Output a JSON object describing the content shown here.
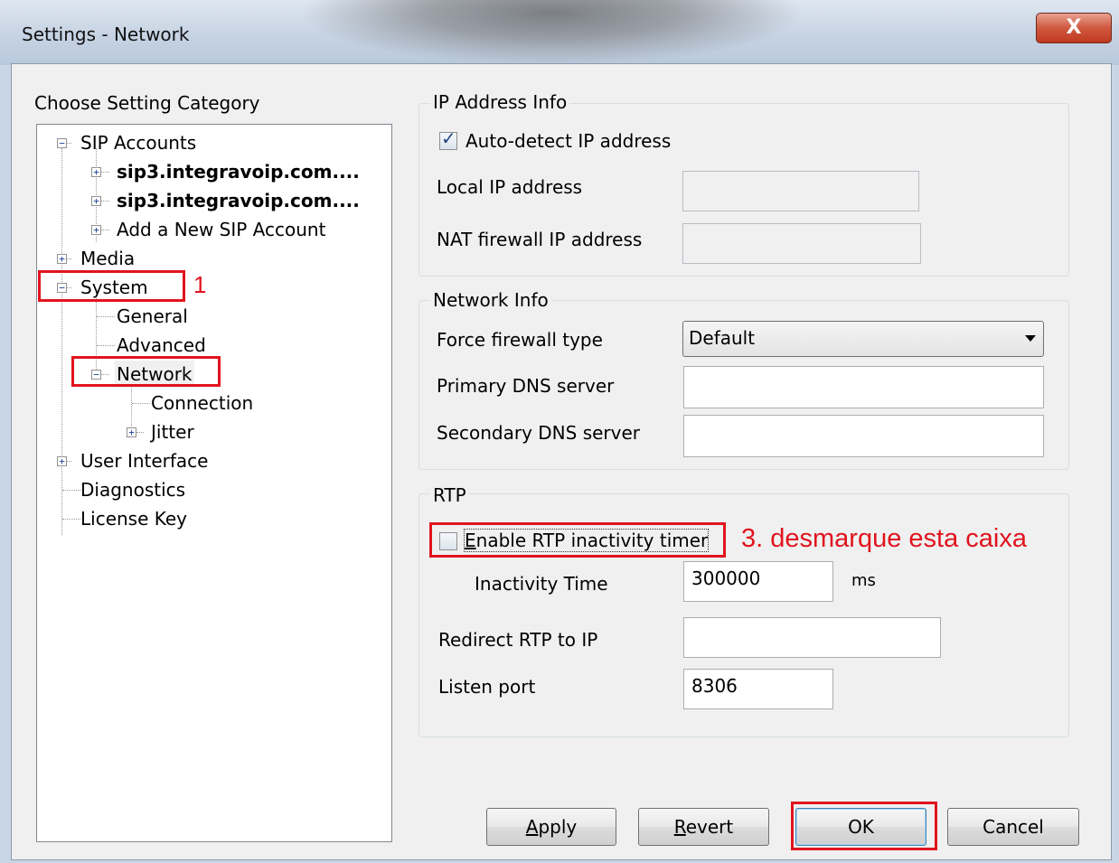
{
  "window": {
    "title": "Settings - Network",
    "close_glyph": "X"
  },
  "categories": {
    "label": "Choose Setting Category",
    "sip_accounts": "SIP Accounts",
    "account_1": "sip3.integravoip.com....",
    "account_2": "sip3.integravoip.com....",
    "add_account": "Add a New SIP Account",
    "media": "Media",
    "system": "System",
    "general": "General",
    "advanced": "Advanced",
    "network": "Network",
    "connection": "Connection",
    "jitter": "Jitter",
    "user_interface": "User Interface",
    "diagnostics": "Diagnostics",
    "license_key": "License Key"
  },
  "ip_info": {
    "legend": "IP Address Info",
    "auto_detect_label": "Auto-detect IP address",
    "auto_detect_checked": true,
    "local_ip_label": "Local IP address",
    "local_ip_value": "",
    "nat_ip_label": "NAT firewall IP address",
    "nat_ip_value": ""
  },
  "network_info": {
    "legend": "Network Info",
    "firewall_label": "Force firewall type",
    "firewall_value": "Default",
    "primary_dns_label": "Primary DNS server",
    "primary_dns_value": "",
    "secondary_dns_label": "Secondary DNS server",
    "secondary_dns_value": ""
  },
  "rtp": {
    "legend": "RTP",
    "enable_timer_label": "Enable RTP inactivity timer",
    "enable_timer_checked": false,
    "inactivity_label": "Inactivity Time",
    "inactivity_value": "300000",
    "inactivity_unit": "ms",
    "redirect_label": "Redirect RTP to IP",
    "redirect_value": "",
    "listen_port_label": "Listen port",
    "listen_port_value": "8306"
  },
  "annotations": {
    "step1": "1",
    "step3": "3. desmarque esta caixa",
    "color": "#e0141e"
  },
  "buttons": {
    "apply": {
      "mnemonic": "A",
      "rest": "pply"
    },
    "revert": {
      "mnemonic": "R",
      "rest": "evert"
    },
    "ok": "OK",
    "cancel": "Cancel"
  }
}
